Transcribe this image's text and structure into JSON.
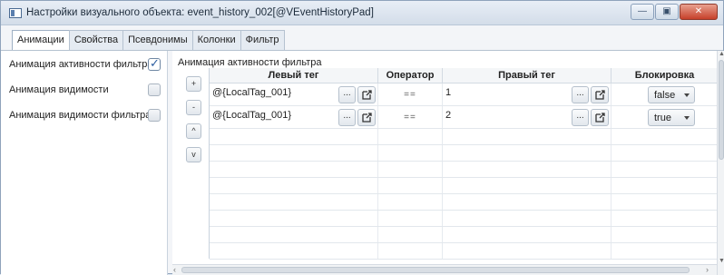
{
  "window": {
    "title": "Настройки визуального объекта: event_history_002[@VEventHistoryPad]",
    "minimize": "—",
    "maximize": "▣",
    "close": "✕"
  },
  "tabs": [
    {
      "label": "Анимации",
      "active": true
    },
    {
      "label": "Свойства",
      "active": false
    },
    {
      "label": "Псевдонимы",
      "active": false
    },
    {
      "label": "Колонки",
      "active": false
    },
    {
      "label": "Фильтр",
      "active": false
    }
  ],
  "animations": [
    {
      "label": "Анимация активности фильтра",
      "checked": true
    },
    {
      "label": "Анимация видимости",
      "checked": false
    },
    {
      "label": "Анимация видимости фильтра",
      "checked": false
    }
  ],
  "section": {
    "title": "Анимация активности фильтра"
  },
  "side_buttons": {
    "add": "+",
    "remove": "-",
    "up": "^",
    "down": "v"
  },
  "table": {
    "columns": [
      "Левый тег",
      "Оператор",
      "Правый тег",
      "Блокировка"
    ],
    "rows": [
      {
        "left_tag": "@{LocalTag_001}",
        "operator": "==",
        "right_tag": "1",
        "lock": "false"
      },
      {
        "left_tag": "@{LocalTag_001}",
        "operator": "==",
        "right_tag": "2",
        "lock": "true"
      }
    ],
    "dots_label": "..."
  },
  "icons": {
    "open_link": "external-link-icon",
    "checkbox_check": "check-icon",
    "dropdown": "chevron-down-icon"
  },
  "colors": {
    "accent": "#2d5fa0",
    "close_button": "#c6402a",
    "titlebar": "#d3dde9"
  }
}
